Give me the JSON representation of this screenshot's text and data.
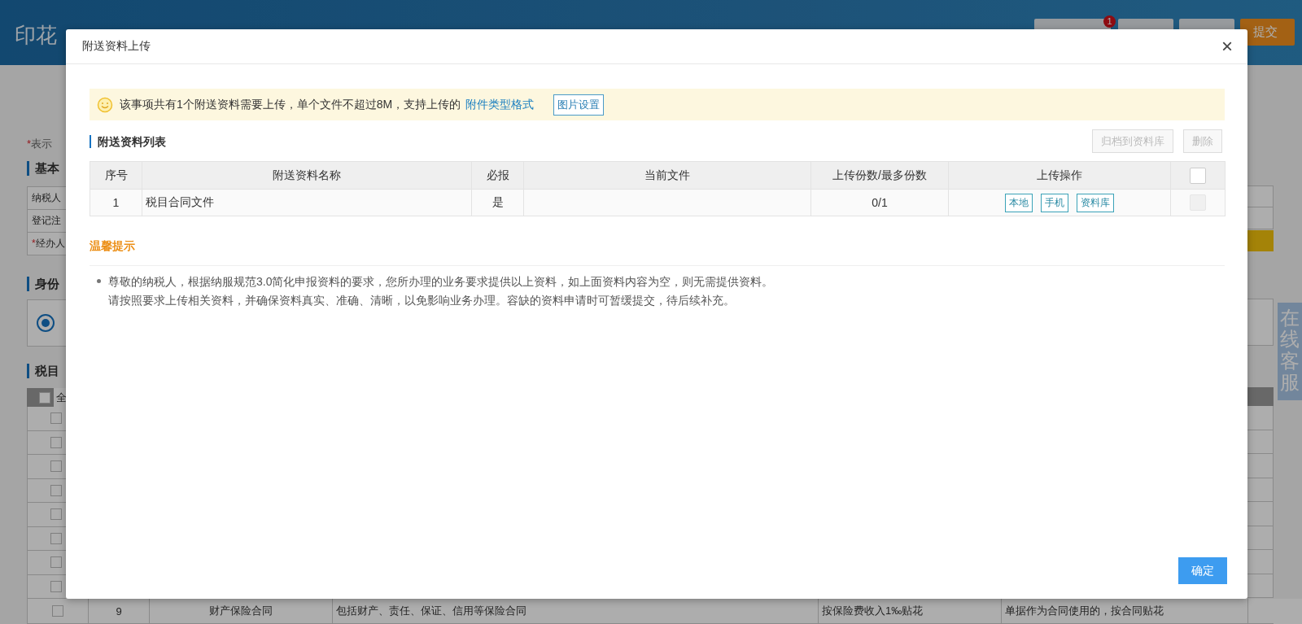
{
  "background_page": {
    "title": "印花",
    "header_buttons": [
      {
        "kind": "grey",
        "badge": "1"
      },
      {
        "kind": "grey"
      },
      {
        "kind": "grey"
      },
      {
        "kind": "primary",
        "label": "提交"
      }
    ],
    "required_note": {
      "mark": "*",
      "label": "表示"
    },
    "basic_title": "基本",
    "basic_rows": [
      {
        "label": "纳税人"
      },
      {
        "label": "登记注"
      },
      {
        "mark": "*",
        "label": "经办人"
      }
    ],
    "identity_title": "身份",
    "identity_radio": {
      "selected": true
    },
    "items_title": "税目",
    "items_header": {
      "label": "全",
      "checked": false
    },
    "hidden_rows": [
      {
        "checked": false
      },
      {
        "checked": false
      },
      {
        "checked": false
      },
      {
        "checked": false
      },
      {
        "checked": false
      },
      {
        "checked": false
      },
      {
        "checked": false
      },
      {
        "checked": false
      }
    ],
    "visible_row": {
      "checked": false,
      "no": "9",
      "name": "财产保险合同",
      "scope": "包括财产、责任、保证、信用等保险合同",
      "rate": "按保险费收入1‰贴花",
      "note": "单据作为合同使用的，按合同贴花"
    },
    "online_service": "在线客服"
  },
  "dialog": {
    "title": "附送资料上传",
    "close": "×",
    "notice": {
      "text": "该事项共有1个附送资料需要上传，单个文件不超过8M，支持上传的",
      "link": "附件类型格式",
      "button": "图片设置"
    },
    "list_title": "附送资料列表",
    "actions": [
      {
        "label": "归档到资料库",
        "disabled": true
      },
      {
        "label": "删除",
        "disabled": true
      }
    ],
    "table": {
      "columns": [
        "序号",
        "附送资料名称",
        "必报",
        "当前文件",
        "上传份数/最多份数",
        "上传操作"
      ],
      "select_all": {
        "checked": false
      },
      "rows": [
        {
          "no": "1",
          "name": "税目合同文件",
          "required": "是",
          "count": "0/1",
          "uploads": [
            "本地",
            "手机",
            "资料库"
          ],
          "checkbox": {
            "checked": false,
            "disabled": true
          }
        }
      ]
    },
    "tips_title": "温馨提示",
    "tips": [
      {
        "lines": [
          "尊敬的纳税人，根据纳服规范3.0简化申报资料的要求，您所办理的业务要求提供以上资料，如上面资料内容为空，则无需提供资料。",
          "请按照要求上传相关资料，并确保资料真实、准确、清晰，以免影响业务办理。容缺的资料申请时可暂缓提交，待后续补充。"
        ]
      }
    ],
    "confirm": "确定"
  }
}
